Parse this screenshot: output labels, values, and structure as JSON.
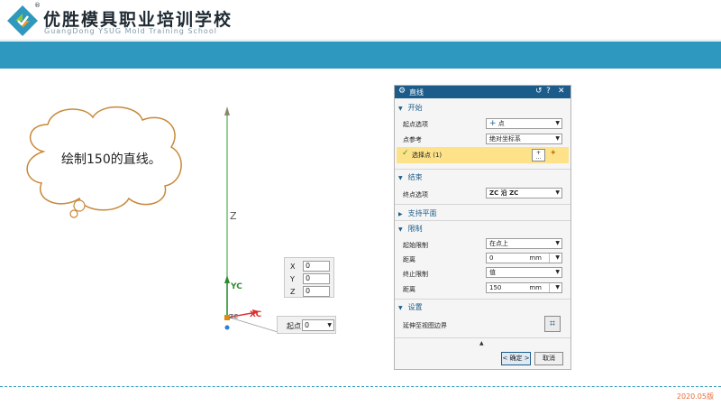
{
  "header": {
    "school_name": "优胜模具职业培训学校",
    "school_en": "GuangDong YSUG Mold Training School",
    "logo_reg_mark": "®"
  },
  "callout": {
    "text": "绘制150的直线。"
  },
  "viewport": {
    "axis_z_label": "Z",
    "axis_yc_label": "YC",
    "axis_xc_label": "XC",
    "axis_zc_label": "ZC"
  },
  "coord_input": {
    "x_label": "X",
    "x_value": "0",
    "y_label": "Y",
    "y_value": "0",
    "z_label": "Z",
    "z_value": "0"
  },
  "start_point_box": {
    "label": "起点",
    "value": "0"
  },
  "dialog": {
    "title": "直线",
    "sections": {
      "start": {
        "header": "开始",
        "start_option_label": "起点选项",
        "start_option_value": "点",
        "point_ref_label": "点参考",
        "point_ref_value": "绝对坐标系",
        "select_point_text": "选择点 (1)"
      },
      "end": {
        "header": "结束",
        "end_option_label": "终点选项",
        "end_option_value": "ZC 沿 ZC"
      },
      "support_plane": {
        "header": "支持平面"
      },
      "limits": {
        "header": "限制",
        "start_limit_label": "起始限制",
        "start_limit_value": "在点上",
        "distance1_label": "距离",
        "distance1_value": "0",
        "distance1_unit": "mm",
        "end_limit_label": "终止限制",
        "end_limit_value": "值",
        "distance2_label": "距离",
        "distance2_value": "150",
        "distance2_unit": "mm"
      },
      "settings": {
        "header": "设置",
        "extend_label": "延伸至视图边界"
      }
    },
    "ok_label": "< 确定 >",
    "cancel_label": "取消"
  },
  "footer": {
    "version": "2020.05版"
  },
  "colors": {
    "banner": "#2f98be",
    "dialog_title": "#1c5c8a",
    "highlight": "#fde28a",
    "version": "#e46b3a"
  }
}
